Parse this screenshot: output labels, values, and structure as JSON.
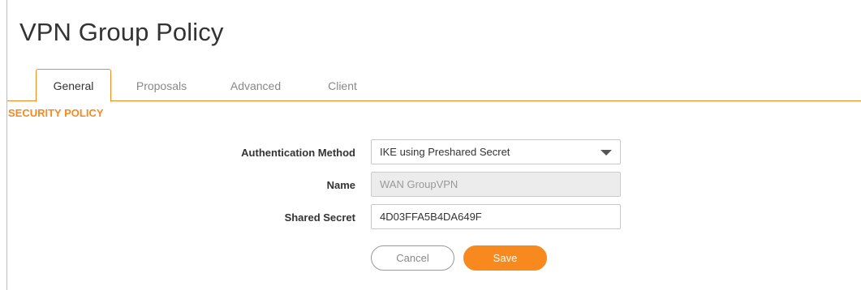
{
  "dialog": {
    "title": "VPN Group Policy"
  },
  "tabs": [
    {
      "label": "General",
      "active": true
    },
    {
      "label": "Proposals",
      "active": false
    },
    {
      "label": "Advanced",
      "active": false
    },
    {
      "label": "Client",
      "active": false
    }
  ],
  "section": {
    "header": "SECURITY POLICY"
  },
  "form": {
    "auth_method": {
      "label": "Authentication Method",
      "value": "IKE using Preshared Secret"
    },
    "name": {
      "label": "Name",
      "value": "WAN GroupVPN",
      "disabled": true
    },
    "shared_secret": {
      "label": "Shared Secret",
      "value": "4D03FFA5B4DA649F"
    }
  },
  "buttons": {
    "cancel_label": "Cancel",
    "save_label": "Save"
  },
  "colors": {
    "accent": "#f7891e",
    "text": "#333333",
    "muted": "#888888",
    "disabled_bg": "#ececec"
  }
}
